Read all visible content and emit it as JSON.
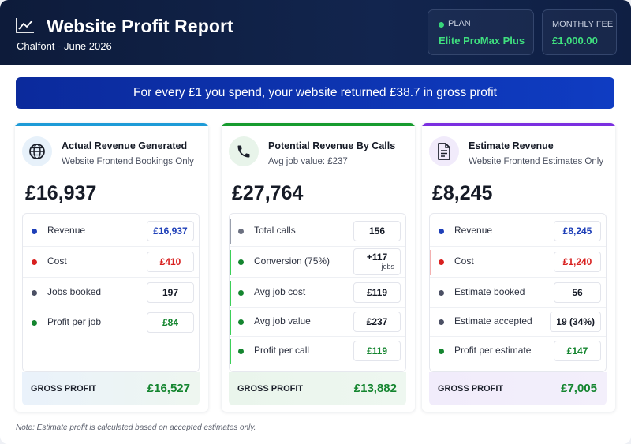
{
  "header": {
    "title": "Website Profit Report",
    "subtitle": "Chalfont - June 2026",
    "plan_label": "PLAN",
    "plan_value": "Elite ProMax Plus",
    "fee_label": "MONTHLY FEE",
    "fee_value": "£1,000.00",
    "icon": "trend-line-icon"
  },
  "banner": {
    "text": "For every £1 you spend, your website returned £38.7 in gross profit"
  },
  "cards": [
    {
      "title": "Actual Revenue Generated",
      "subtitle": "Website Frontend Bookings Only",
      "icon": "globe-icon",
      "accent": "#1e9bd7",
      "total": "£16,937",
      "rows": [
        {
          "label": "Revenue",
          "value": "£16,937"
        },
        {
          "label": "Cost",
          "value": "£410"
        },
        {
          "label": "Jobs booked",
          "value": "197"
        },
        {
          "label": "Profit per job",
          "value": "£84"
        }
      ],
      "footer_label": "GROSS PROFIT",
      "footer_value": "£16,527"
    },
    {
      "title": "Potential Revenue By Calls",
      "subtitle": "Avg job value: £237",
      "icon": "phone-icon",
      "accent": "#179b2e",
      "total": "£27,764",
      "rows": [
        {
          "label": "Total calls",
          "value": "156"
        },
        {
          "label": "Conversion (75%)",
          "value": "+117",
          "value_sub": "jobs"
        },
        {
          "label": "Avg job cost",
          "value": "£119"
        },
        {
          "label": "Avg job value",
          "value": "£237"
        },
        {
          "label": "Profit per call",
          "value": "£119"
        }
      ],
      "footer_label": "GROSS PROFIT",
      "footer_value": "£13,882"
    },
    {
      "title": "Estimate Revenue",
      "subtitle": "Website Frontend Estimates Only",
      "icon": "document-icon",
      "accent": "#7b2fe0",
      "total": "£8,245",
      "rows": [
        {
          "label": "Revenue",
          "value": "£8,245"
        },
        {
          "label": "Cost",
          "value": "£1,240"
        },
        {
          "label": "Estimate booked",
          "value": "56"
        },
        {
          "label": "Estimate accepted",
          "value": "19 (34%)"
        },
        {
          "label": "Profit per estimate",
          "value": "£147"
        }
      ],
      "footer_label": "GROSS PROFIT",
      "footer_value": "£7,005"
    }
  ],
  "note": "Note: Estimate profit is calculated based on accepted estimates only.",
  "colors": {
    "header_bg": "#0d1b3a",
    "banner_bg": "#0f3cc2",
    "positive": "#14852f",
    "negative": "#d8201f",
    "revenue": "#1e3fb8"
  }
}
